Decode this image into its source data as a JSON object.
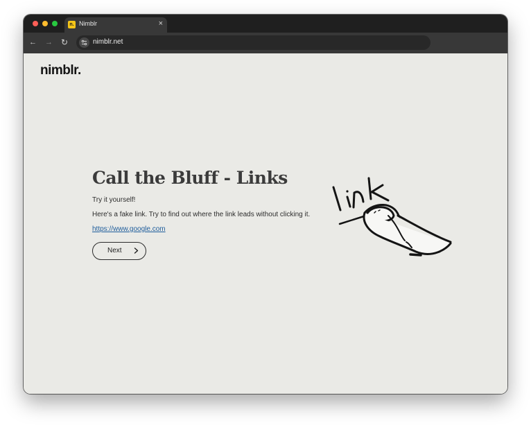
{
  "browser": {
    "tab": {
      "title": "Nimblr",
      "favicon_letter": "n.",
      "close_glyph": "×"
    },
    "nav": {
      "back": "←",
      "forward": "→",
      "reload": "↻"
    },
    "address_bar": {
      "url": "nimblr.net"
    }
  },
  "page": {
    "logo": "nimblr.",
    "heading": "Call the Bluff - Links",
    "intro": "Try it yourself!",
    "instructions": "Here's a fake link. Try to find out where the link leads without clicking it.",
    "fake_link": "https://www.google.com",
    "next_button": "Next"
  },
  "illustration": {
    "handwritten_word": "link"
  },
  "colors": {
    "page_bg": "#eaeae6",
    "tab_bar": "#1f1f1f",
    "toolbar": "#383838",
    "link": "#1d5c9b",
    "heading": "#3b3b3b"
  }
}
